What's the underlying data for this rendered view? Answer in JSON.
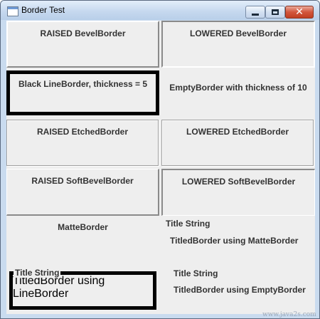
{
  "window": {
    "title": "Border Test",
    "controls": {
      "minimize": "minimize",
      "maximize": "maximize",
      "close": "✕"
    }
  },
  "panels": {
    "raised_bevel": "RAISED BevelBorder",
    "lowered_bevel": "LOWERED BevelBorder",
    "black_line": "Black LineBorder, thickness = 5",
    "empty": "EmptyBorder with thickness of 10",
    "raised_etched": "RAISED EtchedBorder",
    "lowered_etched": "LOWERED EtchedBorder",
    "raised_soft": "RAISED SoftBevelBorder",
    "lowered_soft": "LOWERED SoftBevelBorder",
    "matte": "MatteBorder",
    "titled_matte": {
      "title": "Title String",
      "label": "TitledBorder using MatteBorder"
    },
    "titled_line": {
      "title": "Title String",
      "label": "TitledBorder using LineBorder"
    },
    "titled_empty": {
      "title": "Title String",
      "label": "TitledBorder using EmptyBorder"
    }
  },
  "watermark": "www.java2s.com",
  "colors": {
    "panel_bg": "#eeeeee",
    "text": "#333333",
    "line_border": "#000000"
  }
}
